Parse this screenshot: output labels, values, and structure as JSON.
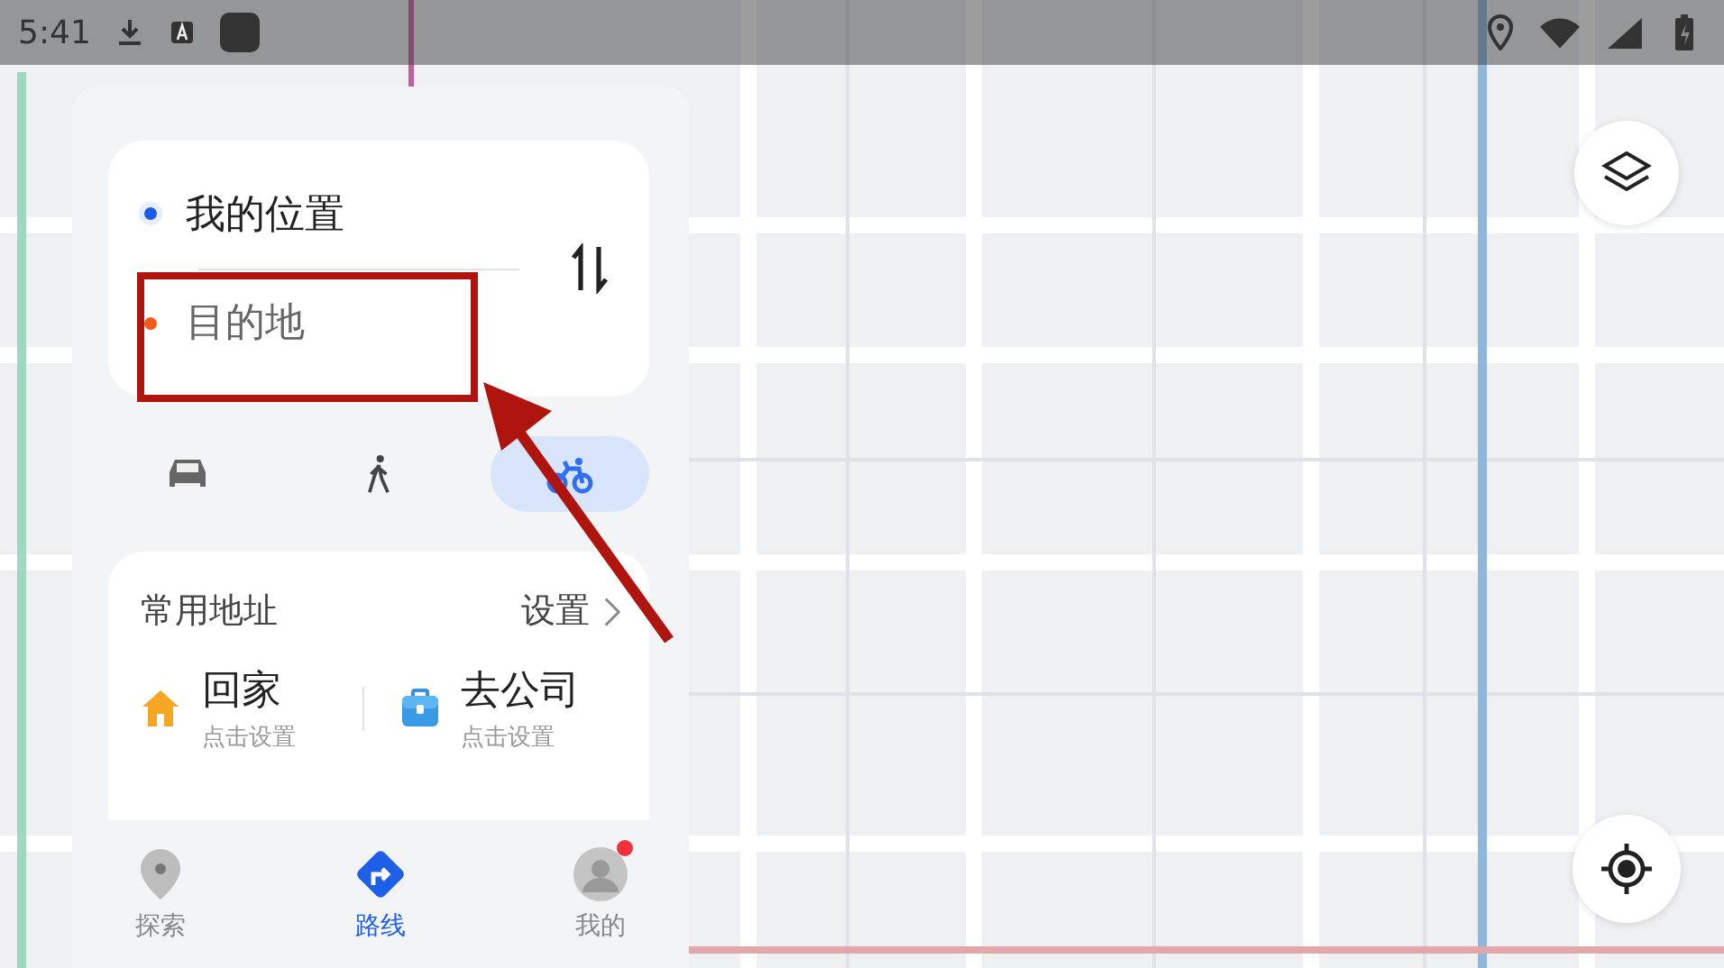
{
  "status_bar": {
    "time": "5:41"
  },
  "route_input": {
    "origin": "我的位置",
    "destination": {
      "placeholder": "目的地"
    }
  },
  "travel_modes": [
    {
      "kind": "car",
      "selected": false
    },
    {
      "kind": "walk",
      "selected": false
    },
    {
      "kind": "bike",
      "selected": true
    }
  ],
  "common_addresses": {
    "title": "常用地址",
    "settings_link": "设置",
    "items": [
      {
        "kind": "home",
        "label": "回家",
        "hint": "点击设置"
      },
      {
        "kind": "work",
        "label": "去公司",
        "hint": "点击设置"
      }
    ]
  },
  "bottom_nav": [
    {
      "kind": "explore",
      "label": "探索",
      "selected": false,
      "badge": false
    },
    {
      "kind": "route",
      "label": "路线",
      "selected": true,
      "badge": false
    },
    {
      "kind": "me",
      "label": "我的",
      "selected": false,
      "badge": true
    }
  ]
}
